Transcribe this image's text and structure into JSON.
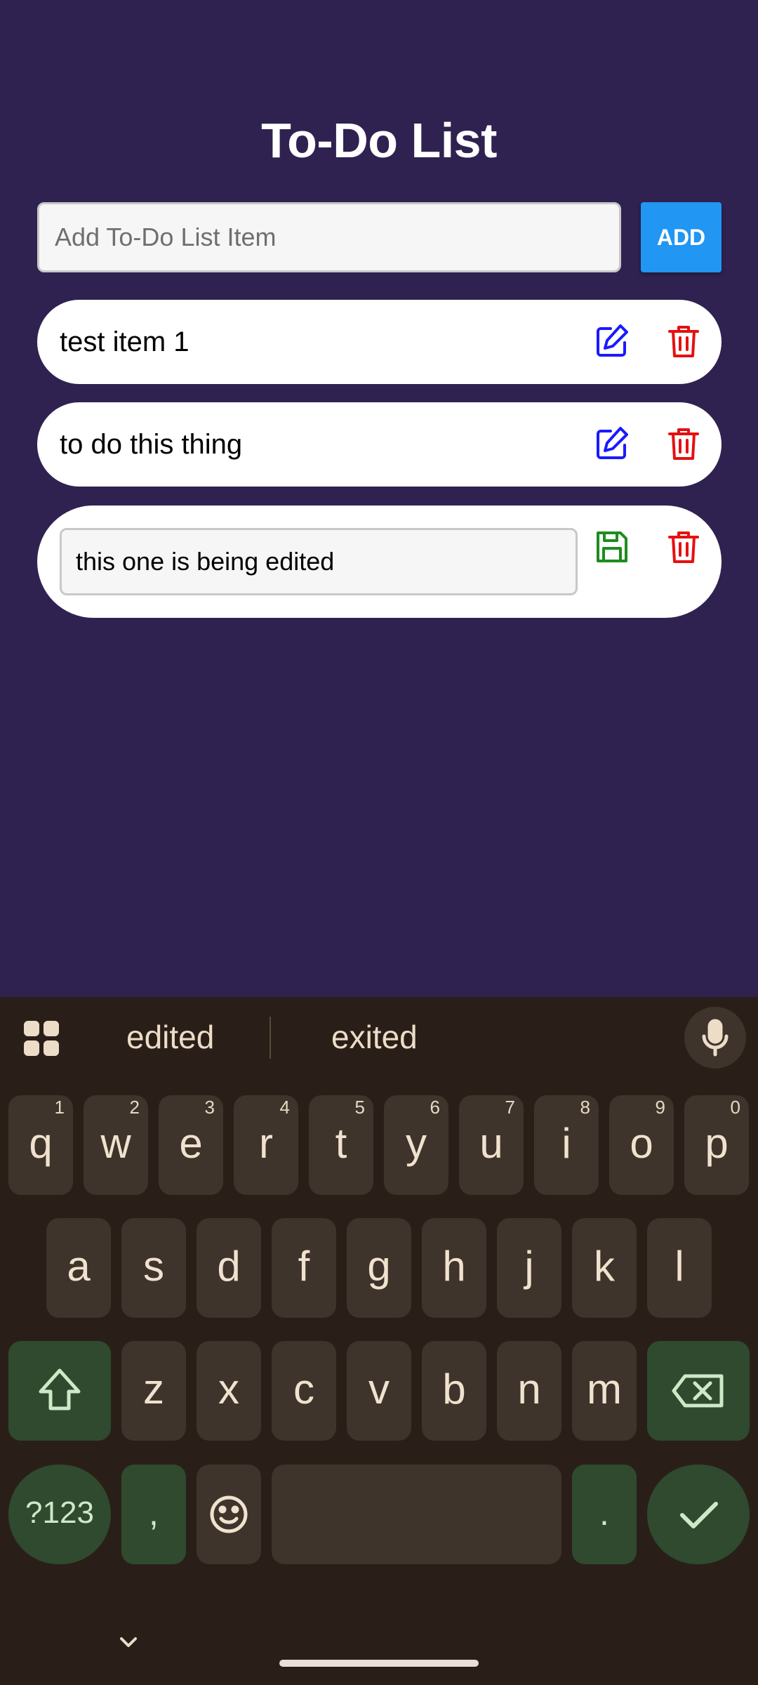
{
  "app": {
    "title": "To-Do List",
    "add_placeholder": "Add To-Do List Item",
    "add_button": "ADD",
    "items": [
      {
        "text": "test item 1",
        "state": "view"
      },
      {
        "text": "to do this thing",
        "state": "view"
      },
      {
        "text": "this one is being edited",
        "state": "editing"
      }
    ],
    "colors": {
      "background": "#2f2250",
      "add_button": "#2196f3",
      "edit_icon": "#1a1aff",
      "delete_icon": "#e61010",
      "save_icon": "#1e8c1e"
    }
  },
  "keyboard": {
    "suggestions": [
      "edited",
      "exited"
    ],
    "row1": [
      {
        "k": "q",
        "n": "1"
      },
      {
        "k": "w",
        "n": "2"
      },
      {
        "k": "e",
        "n": "3"
      },
      {
        "k": "r",
        "n": "4"
      },
      {
        "k": "t",
        "n": "5"
      },
      {
        "k": "y",
        "n": "6"
      },
      {
        "k": "u",
        "n": "7"
      },
      {
        "k": "i",
        "n": "8"
      },
      {
        "k": "o",
        "n": "9"
      },
      {
        "k": "p",
        "n": "0"
      }
    ],
    "row2": [
      "a",
      "s",
      "d",
      "f",
      "g",
      "h",
      "j",
      "k",
      "l"
    ],
    "row3": [
      "z",
      "x",
      "c",
      "v",
      "b",
      "n",
      "m"
    ],
    "symbols_key": "?123",
    "comma_key": ",",
    "period_key": "."
  }
}
